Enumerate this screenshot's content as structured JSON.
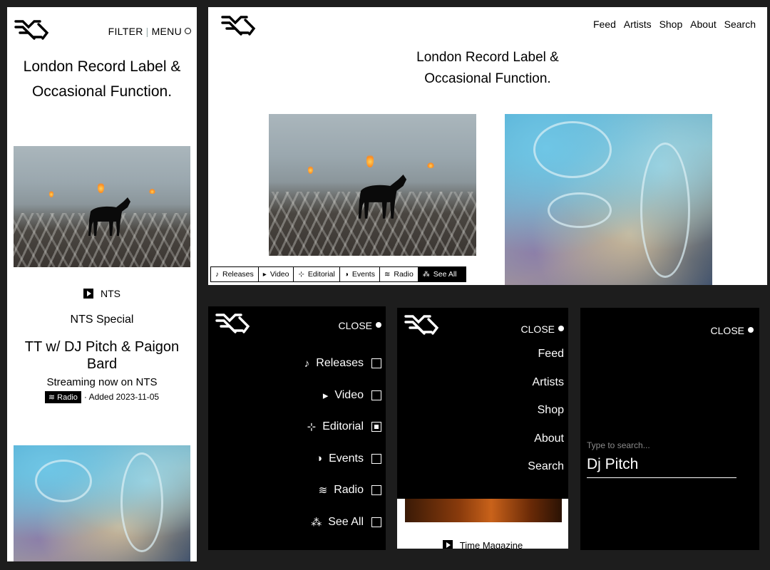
{
  "mobile_home": {
    "filter_label": "FILTER",
    "separator": "|",
    "menu_label": "MENU",
    "tagline_line1": "London Record Label &",
    "tagline_line2": "Occasional Function.",
    "post": {
      "source": "NTS",
      "kicker": "NTS Special",
      "title": "TT w/ DJ Pitch & Paigon Bard",
      "subtitle": "Streaming now on NTS",
      "tag_glyph": "≋",
      "tag_label": "Radio",
      "added": "· Added 2023-11-05"
    }
  },
  "desktop_home": {
    "nav": [
      "Feed",
      "Artists",
      "Shop",
      "About",
      "Search"
    ],
    "tagline_line1": "London Record Label &",
    "tagline_line2": "Occasional Function.",
    "categories": [
      {
        "glyph": "♪",
        "label": "Releases"
      },
      {
        "glyph": "▸",
        "label": "Video"
      },
      {
        "glyph": "⊹",
        "label": "Editorial"
      },
      {
        "glyph": "◑",
        "label": "Events"
      },
      {
        "glyph": "≋",
        "label": "Radio"
      },
      {
        "glyph": "⁂",
        "label": "See All"
      }
    ]
  },
  "filter_overlay": {
    "close_label": "CLOSE",
    "items": [
      {
        "glyph": "♪",
        "label": "Releases",
        "checked": false
      },
      {
        "glyph": "▸",
        "label": "Video",
        "checked": false
      },
      {
        "glyph": "⊹",
        "label": "Editorial",
        "checked": true
      },
      {
        "glyph": "◑",
        "label": "Events",
        "checked": false
      },
      {
        "glyph": "≋",
        "label": "Radio",
        "checked": false
      },
      {
        "glyph": "⁂",
        "label": "See All",
        "checked": false
      }
    ]
  },
  "menu_overlay": {
    "close_label": "CLOSE",
    "items": [
      "Feed",
      "Artists",
      "Shop",
      "About",
      "Search"
    ],
    "peek_source": "Time Magazine"
  },
  "search_overlay": {
    "close_label": "CLOSE",
    "placeholder": "Type to search...",
    "query": "Dj Pitch"
  },
  "colors": {
    "background": "#1d1d1d",
    "panel_light": "#ffffff",
    "panel_dark": "#000000",
    "muted_text": "#8a8a8a"
  }
}
